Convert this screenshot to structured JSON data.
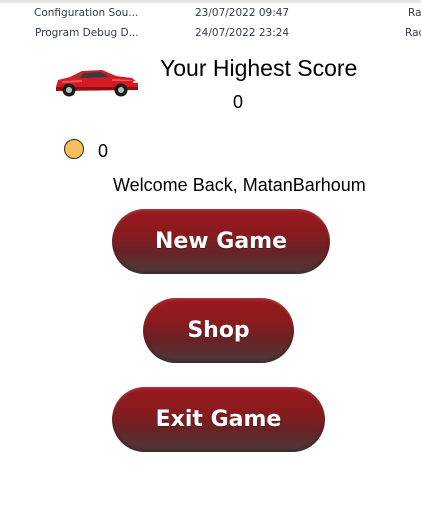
{
  "file_list": {
    "rows": [
      {
        "name": "Configuration Sou...",
        "date": "23/07/2022 09:47",
        "type": "Ra"
      },
      {
        "name": "Program Debug D...",
        "date": "24/07/2022 23:24",
        "type": "Rac"
      }
    ]
  },
  "game": {
    "score_title": "Your Highest Score",
    "highest_score": "0",
    "coins": "0",
    "welcome_text": "Welcome Back, MatanBarhoum",
    "buttons": {
      "new_game": "New Game",
      "shop": "Shop",
      "exit_game": "Exit Game"
    },
    "icons": {
      "car": "red-sports-car-icon",
      "coin": "coin-icon"
    },
    "colors": {
      "button_red": "#8a1a1e",
      "coin_gold": "#f2c061"
    }
  }
}
